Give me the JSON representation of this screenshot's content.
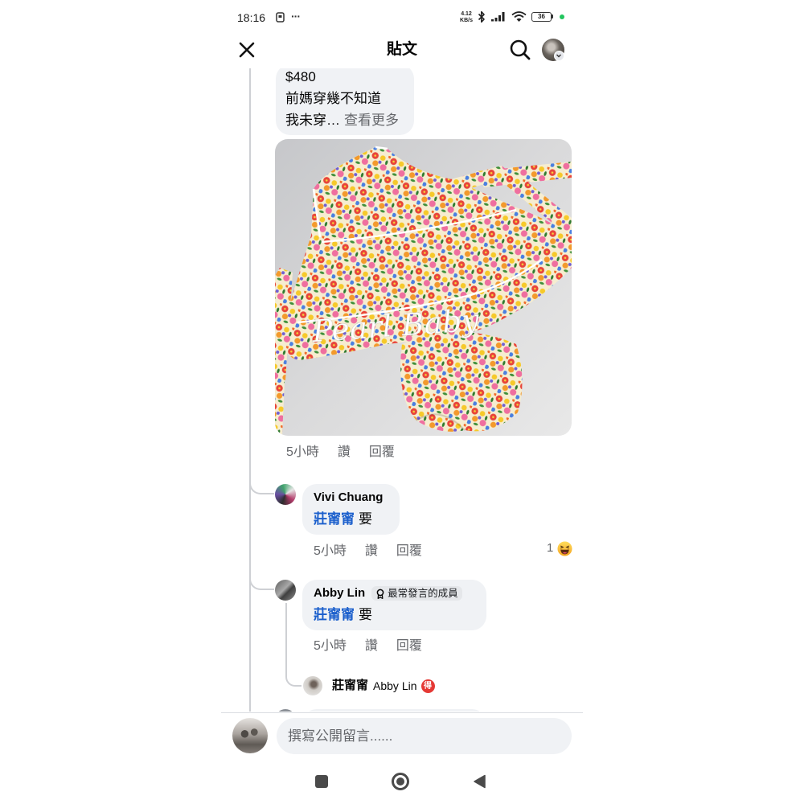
{
  "status_bar": {
    "time": "18:16",
    "overflow_indicator": "···",
    "net_speed_value": "4.12",
    "net_speed_unit": "KB/s",
    "battery_level": "36"
  },
  "header": {
    "title": "貼文"
  },
  "post": {
    "lines": [
      "$480",
      "前媽穿幾不知道",
      "我未穿…"
    ],
    "see_more": "查看更多",
    "watermark": "Pearl Baby",
    "meta": {
      "time": "5小時",
      "like": "讚",
      "reply": "回覆"
    }
  },
  "comments": [
    {
      "author": "Vivi Chuang",
      "mention": "莊甯甯",
      "text": "要",
      "meta": {
        "time": "5小時",
        "like": "讚",
        "reply": "回覆"
      },
      "reaction_count": "1",
      "reaction": "haha"
    },
    {
      "author": "Abby Lin",
      "badge": "最常發言的成員",
      "mention": "莊甯甯",
      "text": "要",
      "meta": {
        "time": "5小時",
        "like": "讚",
        "reply": "回覆"
      }
    }
  ],
  "reply_preview": {
    "author": "莊甯甯",
    "replying_to": "Abby Lin",
    "emoji_glyph": "得"
  },
  "composer": {
    "placeholder": "撰寫公開留言......"
  },
  "icons": {
    "close": "close-icon",
    "search": "search-icon",
    "bluetooth": "bluetooth-icon",
    "signal": "signal-icon",
    "wifi": "wifi-icon",
    "battery": "battery-icon",
    "top_fan": "award-icon",
    "reaction": "haha-reaction-icon",
    "nav": [
      "recents-icon",
      "home-icon",
      "back-icon"
    ]
  },
  "colors": {
    "link": "#1b5fcc",
    "bubble": "#f0f2f5",
    "meta_text": "#65676b",
    "online_dot": "#22c55e",
    "emoji_badge": "#e53935"
  }
}
